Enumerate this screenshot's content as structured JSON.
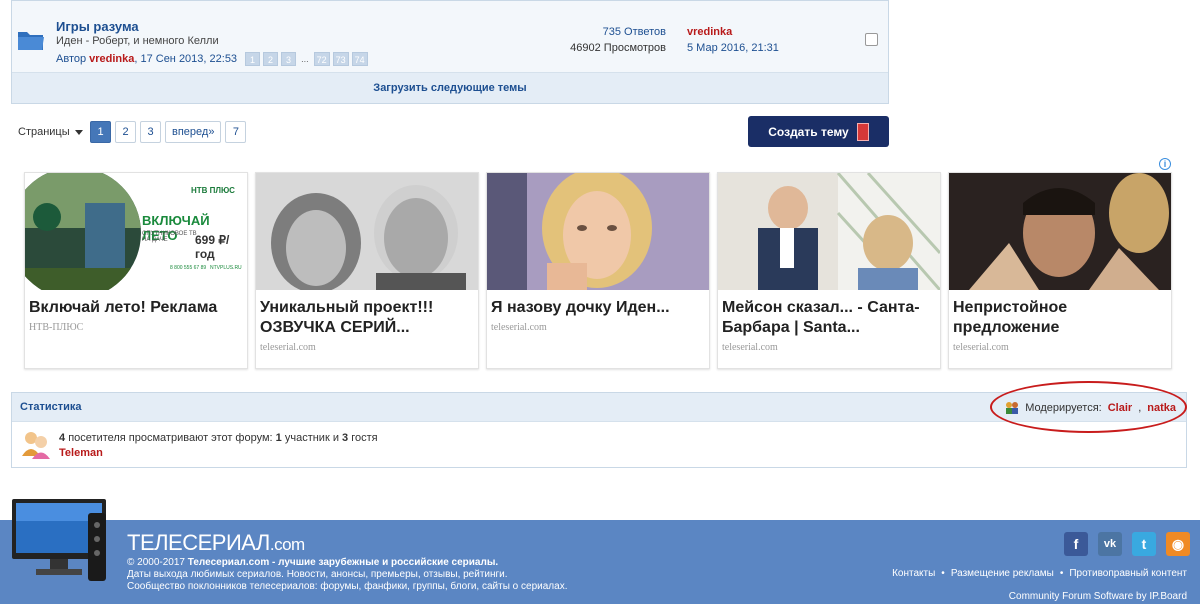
{
  "topic": {
    "title": "Игры разума",
    "description": "Иден - Роберт, и немного Келли",
    "author_prefix": "Автор",
    "author": "vredinka",
    "date": ", 17 Сен 2013, 22:53",
    "pages": [
      "1",
      "2",
      "3",
      "...",
      "72",
      "73",
      "74"
    ],
    "replies": "735 Ответов",
    "views": "46902 Просмотров",
    "last_user": "vredinka",
    "last_date": "5 Мар 2016, 21:31"
  },
  "load_more": "Загрузить следующие темы",
  "pagination": {
    "label": "Страницы",
    "items": [
      "1",
      "2",
      "3",
      "вперед»",
      "7"
    ],
    "active": "1"
  },
  "create_button": "Создать тему",
  "ads": [
    {
      "title": "Включай лето! Реклама",
      "source": "НТВ-ПЛЮС",
      "banner_title": "ВКЛЮЧАЙ ЛЕТО",
      "banner_sub": "СПУТНИКОВОЕ ТВ НА ДАЧЕ",
      "banner_price": "699 ₽/год",
      "banner_brand": "НТВ ПЛЮС",
      "banner_phone": "8 800 555 67 89",
      "banner_site": "NTVPLUS.RU"
    },
    {
      "title": "Уникальный проект!!! ОЗВУЧКА СЕРИЙ...",
      "source": "teleserial.com"
    },
    {
      "title": "Я назову дочку Иден...",
      "source": "teleserial.com"
    },
    {
      "title": "Мейсон сказал... - Санта-Барбара | Santa...",
      "source": "teleserial.com"
    },
    {
      "title": "Непристойное предложение",
      "source": "teleserial.com"
    }
  ],
  "stats": {
    "title": "Статистика",
    "moderated_label": "Модерируется:",
    "moderator1": "Clair",
    "moderator_sep": ",",
    "moderator2": "natka",
    "visitors_count": "4",
    "visitors_text": "посетителя просматривают этот форум:",
    "members_count": "1",
    "members_text": "участник и",
    "guests_count": "3",
    "guests_text": "гостя",
    "online_user": "Teleman"
  },
  "footer": {
    "logo": "ТЕЛЕСЕРИАЛ",
    "logo_suffix": ".com",
    "copyright_prefix": "© 2000-2017",
    "site_name": "Телесериал.com",
    "tagline": " - лучшие зарубежные и российские сериалы.",
    "line2": "Даты выхода любимых сериалов. Новости, анонсы, премьеры, отзывы, рейтинги.",
    "line3": "Сообщество поклонников телесериалов: форумы, фанфики, группы, блоги, сайты о сериалах.",
    "links": [
      "Контакты",
      "Размещение рекламы",
      "Противоправный контент"
    ],
    "powered": "Community Forum Software by IP.Board",
    "socials": [
      {
        "name": "facebook",
        "glyph": "f",
        "color": "#3b5998"
      },
      {
        "name": "vk",
        "glyph": "vk",
        "color": "#4c75a3"
      },
      {
        "name": "twitter",
        "glyph": "t",
        "color": "#39a9e0"
      },
      {
        "name": "rss",
        "glyph": "◉",
        "color": "#f08a24"
      }
    ]
  },
  "colors": {
    "accent": "#1d4f91",
    "user_red": "#b81a1a",
    "create_button_bg": "#1a2e66",
    "footer_bg": "#5b86c3"
  }
}
